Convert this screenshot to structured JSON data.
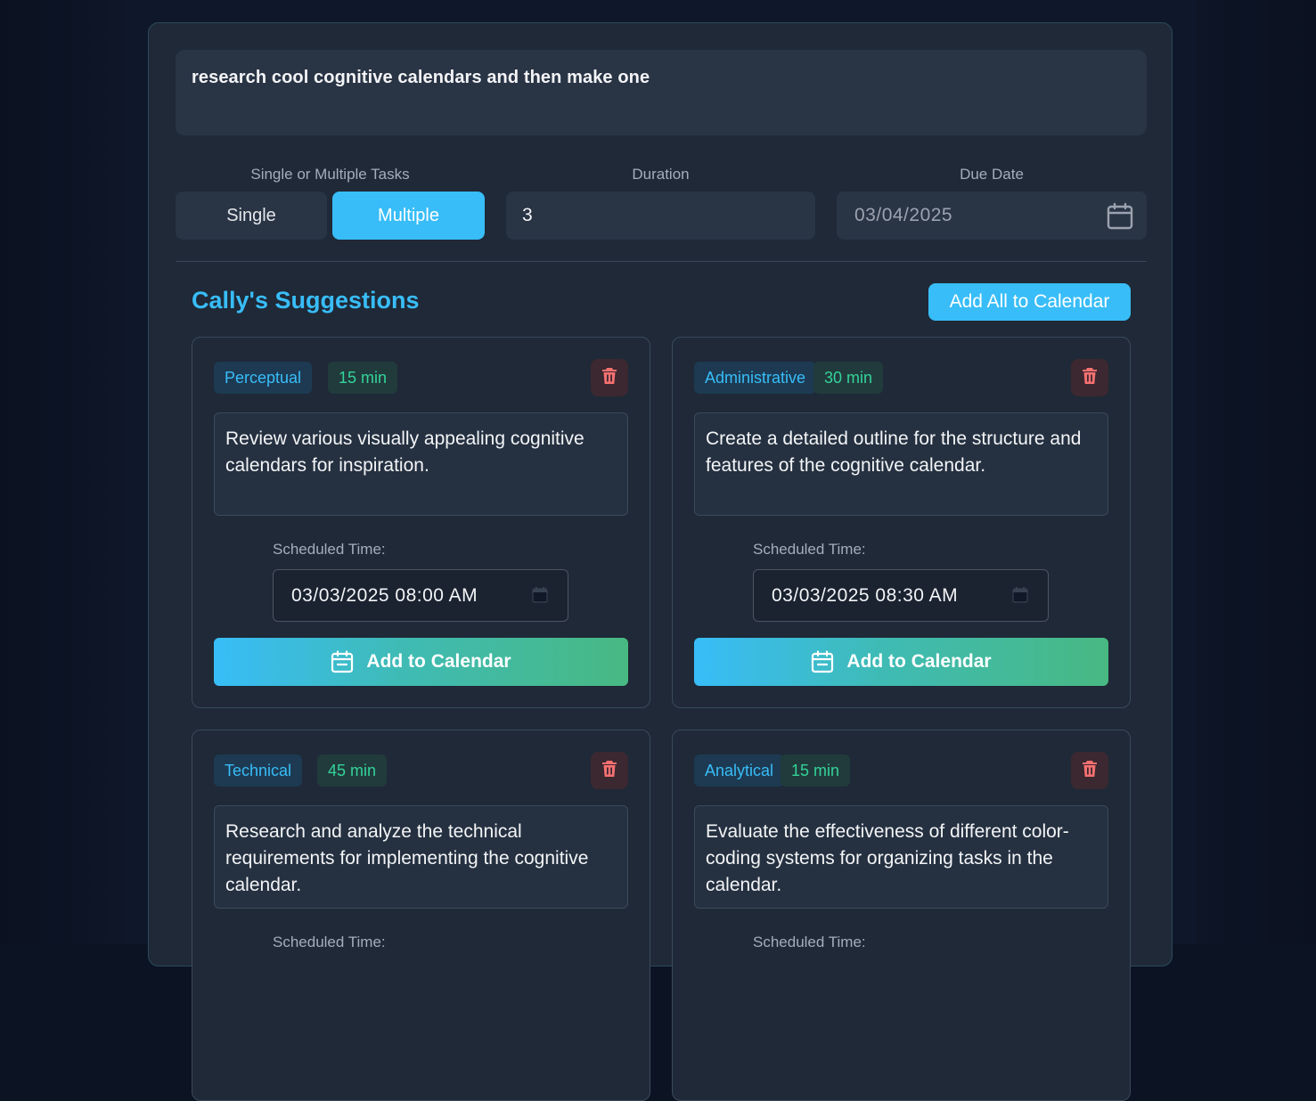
{
  "task_input": {
    "value": "research cool cognitive calendars and then make one"
  },
  "form": {
    "mode_label": "Single or Multiple Tasks",
    "single_label": "Single",
    "multiple_label": "Multiple",
    "duration_label": "Duration",
    "duration_value": "3",
    "due_date_label": "Due Date",
    "due_date_value": "03/04/2025"
  },
  "suggestions": {
    "title": "Cally's Suggestions",
    "add_all_label": "Add All to Calendar",
    "cards": [
      {
        "category": "Perceptual",
        "duration": "15 min",
        "description": "Review various visually appealing cognitive calendars for inspiration.",
        "scheduled_label": "Scheduled Time:",
        "scheduled_value": "03/03/2025 08:00  AM",
        "add_label": "Add to Calendar"
      },
      {
        "category": "Administrative",
        "duration": "30 min",
        "description": "Create a detailed outline for the structure and features of the cognitive calendar.",
        "scheduled_label": "Scheduled Time:",
        "scheduled_value": "03/03/2025 08:30  AM",
        "add_label": "Add to Calendar"
      },
      {
        "category": "Technical",
        "duration": "45 min",
        "description": "Research and analyze the technical requirements for implementing the cognitive calendar.",
        "scheduled_label": "Scheduled Time:",
        "scheduled_value": "",
        "add_label": ""
      },
      {
        "category": "Analytical",
        "duration": "15 min",
        "description": "Evaluate the effectiveness of different color-coding systems for organizing tasks in the calendar.",
        "scheduled_label": "Scheduled Time:",
        "scheduled_value": "",
        "add_label": ""
      }
    ]
  },
  "icons": {
    "calendar": "calendar-icon",
    "delete": "trash-icon"
  },
  "colors": {
    "accent": "#38bdf8",
    "success": "#34d399",
    "danger": "#f87171",
    "panel": "#1f2937"
  }
}
